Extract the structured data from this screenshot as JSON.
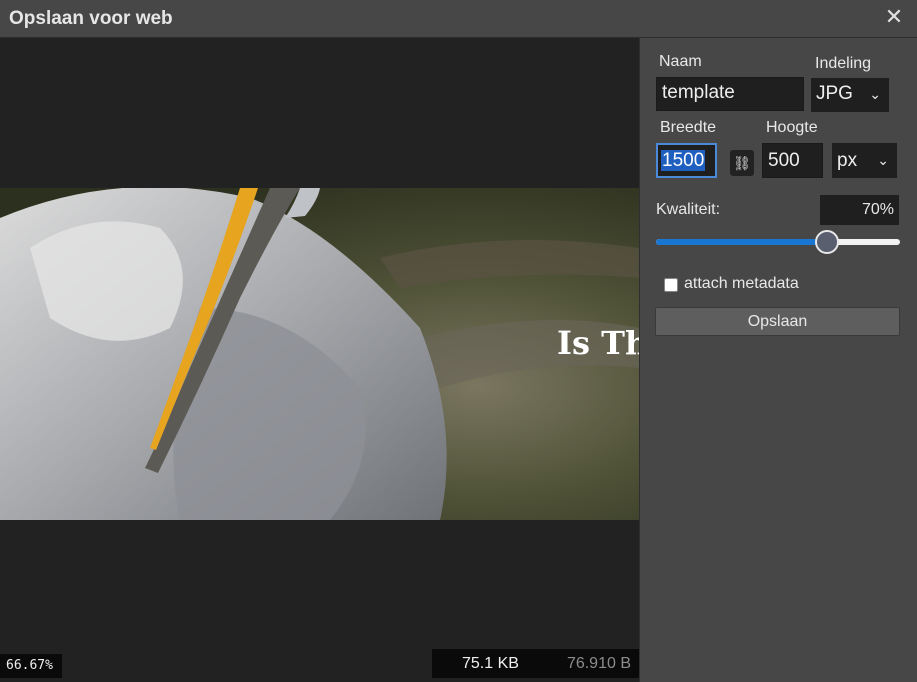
{
  "window": {
    "title": "Opslaan voor web"
  },
  "preview": {
    "overlay_text": "Is Thi",
    "zoom": "66.67%",
    "file_size_kb": "75.1 KB",
    "file_size_bytes": "76.910 B"
  },
  "panel": {
    "name_label": "Naam",
    "name_value": "template",
    "format_label": "Indeling",
    "format_value": "JPG",
    "width_label": "Breedte",
    "width_value": "1500",
    "height_label": "Hoogte",
    "height_value": "500",
    "unit_value": "px",
    "quality_label": "Kwaliteit:",
    "quality_value": "70%",
    "quality_fraction": 0.7,
    "metadata_label": "attach metadata",
    "metadata_checked": false,
    "save_label": "Opslaan"
  },
  "colors": {
    "accent": "#1976d2",
    "panel": "#474747",
    "canvas": "#222222"
  }
}
